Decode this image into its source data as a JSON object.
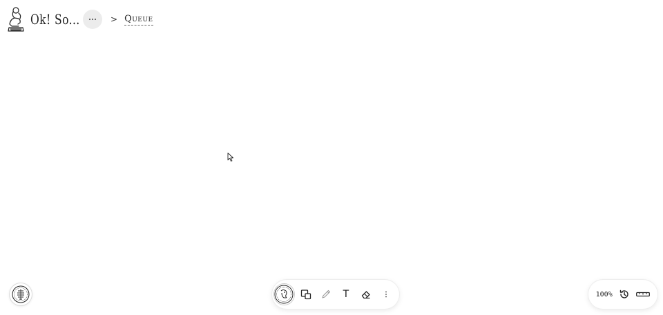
{
  "header": {
    "brand": "Ok! So...",
    "more_label": "•••",
    "separator": ">",
    "breadcrumb_current": "Queue"
  },
  "toolbar": {
    "tools": [
      {
        "name": "shapes",
        "icon": "shapes-icon"
      },
      {
        "name": "pencil",
        "icon": "pencil-icon"
      },
      {
        "name": "text",
        "icon": "text-icon",
        "label": "T"
      },
      {
        "name": "eraser",
        "icon": "eraser-icon"
      },
      {
        "name": "more",
        "icon": "vertical-dots-icon"
      }
    ]
  },
  "zoom": {
    "level": "100%"
  },
  "colors": {
    "background": "#ffffff",
    "text": "#222222",
    "pill": "#ececec"
  }
}
